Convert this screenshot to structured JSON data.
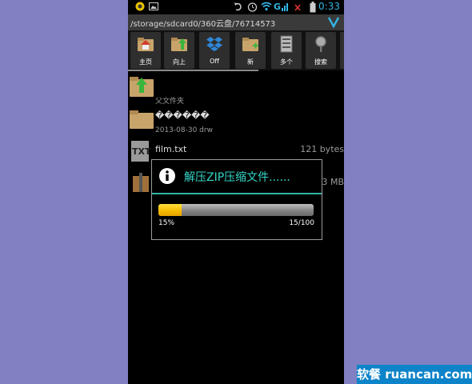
{
  "statusbar": {
    "time": "0:33"
  },
  "path": {
    "text": "/storage/sdcard0/360云盘/76714573"
  },
  "toolbar": {
    "buttons": [
      {
        "label": "主页",
        "icon": "home-folder-icon"
      },
      {
        "label": "向上",
        "icon": "folder-up-icon"
      },
      {
        "label": "Off",
        "icon": "dropbox-icon"
      },
      {
        "label": "新",
        "icon": "new-folder-icon"
      },
      {
        "label": "多个",
        "icon": "multi-select-icon"
      },
      {
        "label": "搜索",
        "icon": "search-icon"
      }
    ]
  },
  "files": [
    {
      "name": "",
      "sub": "父文件夹",
      "size": ""
    },
    {
      "name": "������",
      "sub": "2013-08-30 drw",
      "size": ""
    },
    {
      "name": "film.txt",
      "sub": "",
      "size": "121 bytes"
    },
    {
      "name": "",
      "sub": "",
      "size": "3 MB"
    }
  ],
  "dialog": {
    "title": "解压ZIP压缩文件......",
    "progress_fraction": 0.15,
    "percent_text": "15%",
    "count_text": "15/100"
  },
  "watermark": {
    "text": "软餐 ruancan.com"
  },
  "colors": {
    "accent": "#33b5e5",
    "dialog_title": "#33d6c8",
    "progress_fill": "#f5b800",
    "background": "#8080c2"
  }
}
